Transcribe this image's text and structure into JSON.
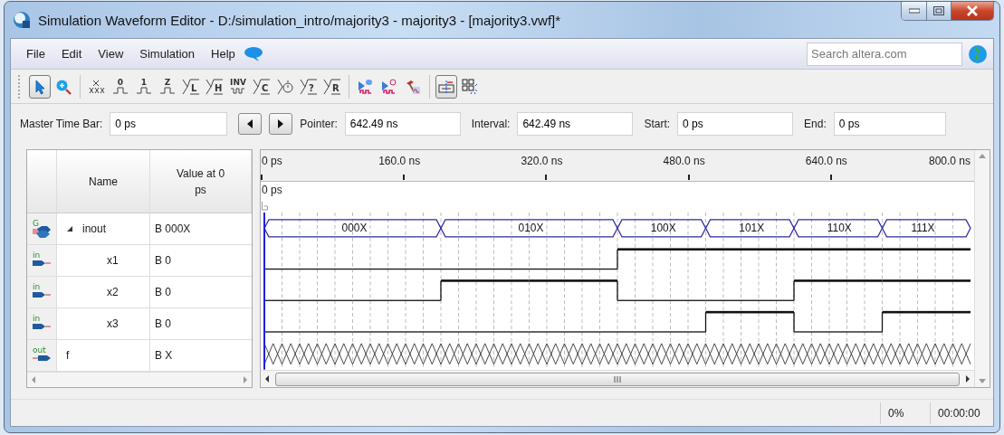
{
  "window": {
    "title": "Simulation Waveform Editor - D:/simulation_intro/majority3 - majority3 - [majority3.vwf]*"
  },
  "menu": [
    "File",
    "Edit",
    "View",
    "Simulation",
    "Help"
  ],
  "search": {
    "placeholder": "Search altera.com"
  },
  "toolbar": [
    {
      "kind": "pointer",
      "selected": true
    },
    {
      "kind": "zoom",
      "selected": false
    },
    {
      "kind": "separator"
    },
    {
      "kind": "unknown",
      "selected": false
    },
    {
      "kind": "level",
      "glyph": "0",
      "selected": false
    },
    {
      "kind": "level",
      "glyph": "1",
      "selected": false
    },
    {
      "kind": "level",
      "glyph": "Z",
      "selected": false
    },
    {
      "kind": "bracket",
      "glyph": "L",
      "selected": false
    },
    {
      "kind": "bracket",
      "glyph": "H",
      "selected": false
    },
    {
      "kind": "invert",
      "glyph": "INV",
      "selected": false
    },
    {
      "kind": "bracket",
      "glyph": "C",
      "selected": false
    },
    {
      "kind": "clock",
      "selected": false
    },
    {
      "kind": "bracket",
      "glyph": "?",
      "selected": false
    },
    {
      "kind": "bracket",
      "glyph": "R",
      "selected": false
    },
    {
      "kind": "separator"
    },
    {
      "kind": "run-functional",
      "selected": false
    },
    {
      "kind": "run-timing",
      "selected": false
    },
    {
      "kind": "netlist",
      "selected": false
    },
    {
      "kind": "separator"
    },
    {
      "kind": "snap",
      "selected": true
    },
    {
      "kind": "group",
      "selected": false
    }
  ],
  "time_bar": {
    "master": {
      "label": "Master Time Bar:",
      "value": "0 ps"
    },
    "fields": [
      {
        "label": "Pointer:",
        "value": "642.49 ns"
      },
      {
        "label": "Interval:",
        "value": "642.49 ns"
      },
      {
        "label": "Start:",
        "value": "0 ps"
      },
      {
        "label": "End:",
        "value": "0 ps"
      }
    ]
  },
  "signal_table": {
    "columns": [
      "Name",
      "Value at 0 ps"
    ],
    "signals": [
      {
        "kind": "bus",
        "pin": "G",
        "name": "inout",
        "value": "B 000X",
        "expanded": true,
        "segments": [
          {
            "label": "000X"
          },
          {
            "label": "010X"
          },
          {
            "label": "100X"
          },
          {
            "label": "101X"
          },
          {
            "label": "110X"
          },
          {
            "label": "111X"
          }
        ],
        "children": [
          {
            "kind": "input",
            "pin": "in",
            "name": "x1",
            "value": "B 0",
            "wave": [
              {
                "high": false
              },
              {
                "high": false
              },
              {
                "high": false
              },
              {
                "high": false
              },
              {
                "high": true
              },
              {
                "high": true
              },
              {
                "high": true
              },
              {
                "high": true
              }
            ]
          },
          {
            "kind": "input",
            "pin": "in",
            "name": "x2",
            "value": "B 0",
            "wave": [
              {
                "high": false
              },
              {
                "high": false
              },
              {
                "high": true
              },
              {
                "high": true
              },
              {
                "high": false
              },
              {
                "high": false
              },
              {
                "high": true
              },
              {
                "high": true
              }
            ]
          },
          {
            "kind": "input",
            "pin": "in",
            "name": "x3",
            "value": "B 0",
            "wave": [
              {
                "high": false
              },
              {
                "high": false
              },
              {
                "high": false
              },
              {
                "high": false
              },
              {
                "high": false
              },
              {
                "high": true
              },
              {
                "high": false
              },
              {
                "high": true
              }
            ]
          }
        ]
      },
      {
        "kind": "output",
        "pin": "out",
        "name": "f",
        "value": "B X",
        "wave": [
          {
            "unknown": true
          },
          {
            "unknown": true
          },
          {
            "unknown": true
          },
          {
            "unknown": true
          },
          {
            "unknown": true
          },
          {
            "unknown": true
          },
          {
            "unknown": true
          },
          {
            "unknown": true
          }
        ]
      }
    ]
  },
  "waveform": {
    "ticks": [
      "0 ps",
      "160.0 ns",
      "320.0 ns",
      "480.0 ns",
      "640.0 ns",
      "800.0 ns"
    ],
    "cursor": "0 ps"
  },
  "status_bar": {
    "progress": "0%",
    "elapsed": "00:00:00"
  }
}
